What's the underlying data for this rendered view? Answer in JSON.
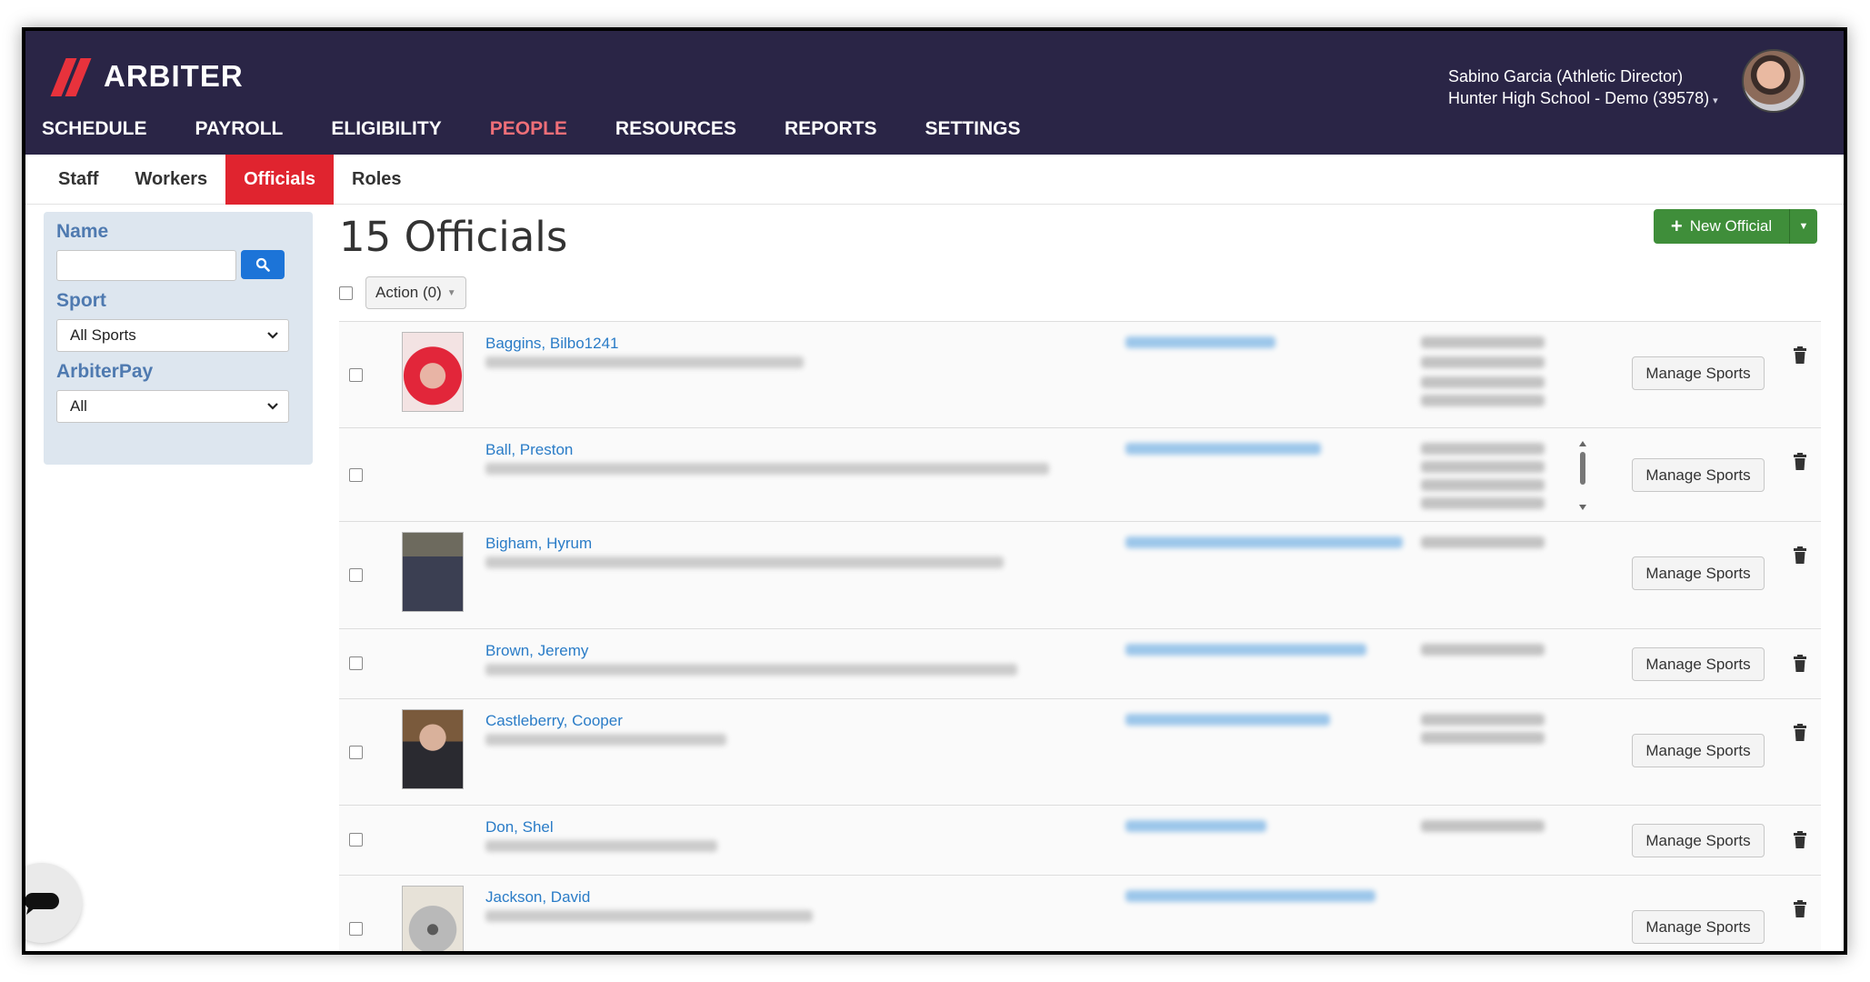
{
  "brand": {
    "name": "ARBITER",
    "accent": "#e0242f",
    "header_bg": "#2a2546"
  },
  "main_nav": [
    {
      "label": "SCHEDULE",
      "active": false
    },
    {
      "label": "PAYROLL",
      "active": false
    },
    {
      "label": "ELIGIBILITY",
      "active": false
    },
    {
      "label": "PEOPLE",
      "active": true
    },
    {
      "label": "RESOURCES",
      "active": false
    },
    {
      "label": "REPORTS",
      "active": false
    },
    {
      "label": "SETTINGS",
      "active": false
    }
  ],
  "user": {
    "name_role": "Sabino Garcia (Athletic Director)",
    "school": "Hunter High School - Demo (39578)"
  },
  "sub_nav": [
    {
      "label": "Staff",
      "active": false
    },
    {
      "label": "Workers",
      "active": false
    },
    {
      "label": "Officials",
      "active": true
    },
    {
      "label": "Roles",
      "active": false
    }
  ],
  "filters": {
    "name_label": "Name",
    "name_value": "",
    "sport_label": "Sport",
    "sport_selected": "All Sports",
    "arbiterpay_label": "ArbiterPay",
    "arbiterpay_selected": "All"
  },
  "page": {
    "title": "15 Officials",
    "new_button": "New Official",
    "action_button": "Action (0)"
  },
  "officials": [
    {
      "name": "Baggins, Bilbo1241",
      "photo": "red-wig"
    },
    {
      "name": "Ball, Preston",
      "photo": "none"
    },
    {
      "name": "Bigham, Hyrum",
      "photo": "portrait-dark"
    },
    {
      "name": "Brown, Jeremy",
      "photo": "none"
    },
    {
      "name": "Castleberry, Cooper",
      "photo": "portrait-suit"
    },
    {
      "name": "Don, Shel",
      "photo": "none"
    },
    {
      "name": "Jackson, David",
      "photo": "koala"
    }
  ],
  "row_action_label": "Manage Sports"
}
